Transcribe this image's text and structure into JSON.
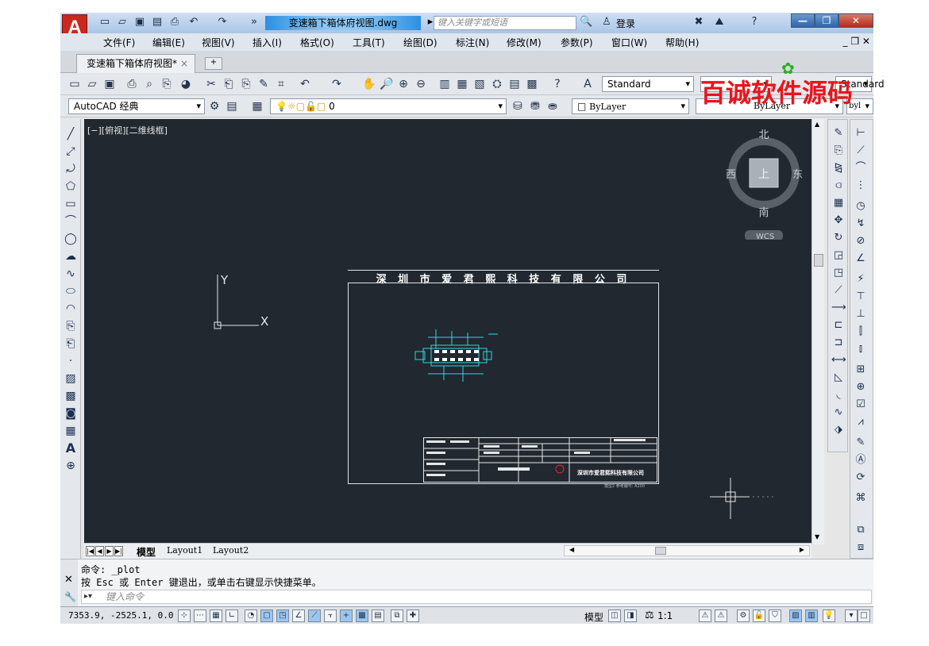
{
  "app": {
    "doc_title": "变速箱下箱体府视图.dwg",
    "search_placeholder": "键入关键字或短语",
    "login": "登录"
  },
  "menu": [
    "文件(F)",
    "编辑(E)",
    "视图(V)",
    "插入(I)",
    "格式(O)",
    "工具(T)",
    "绘图(D)",
    "标注(N)",
    "修改(M)",
    "参数(P)",
    "窗口(W)",
    "帮助(H)"
  ],
  "tab": {
    "label": "变速箱下箱体府视图*",
    "close": "×"
  },
  "watermark": "百诚软件源码",
  "toolbar": {
    "text_style": "Standard",
    "workspace": "AutoCAD 经典",
    "layer": "0",
    "color": "ByLayer",
    "linetype": "ByLayer",
    "lineweight": "byl"
  },
  "viewport": {
    "label": "[−][俯视][二维线框]",
    "cube_north": "北",
    "cube_south": "南",
    "cube_east": "东",
    "cube_west": "西",
    "cube_top": "上",
    "wcs": "WCS",
    "ucs_x": "X",
    "ucs_y": "Y"
  },
  "drawing": {
    "company_title": "深 圳 市 爱 君 熙 科 技 有 限 公 司",
    "company_small": "深圳市爱君熙科技有限公司",
    "bottom_text": "模型2 参考编号: A200"
  },
  "layouts": [
    "模型",
    "Layout1",
    "Layout2"
  ],
  "command": {
    "line1": "命令: _plot",
    "line2": "按 Esc 或 Enter 键退出，或单击右键显示快捷菜单。",
    "placeholder": "键入命令"
  },
  "status": {
    "coords": "7353.9, -2525.1, 0.0",
    "model": "模型",
    "scale": "1:1"
  }
}
